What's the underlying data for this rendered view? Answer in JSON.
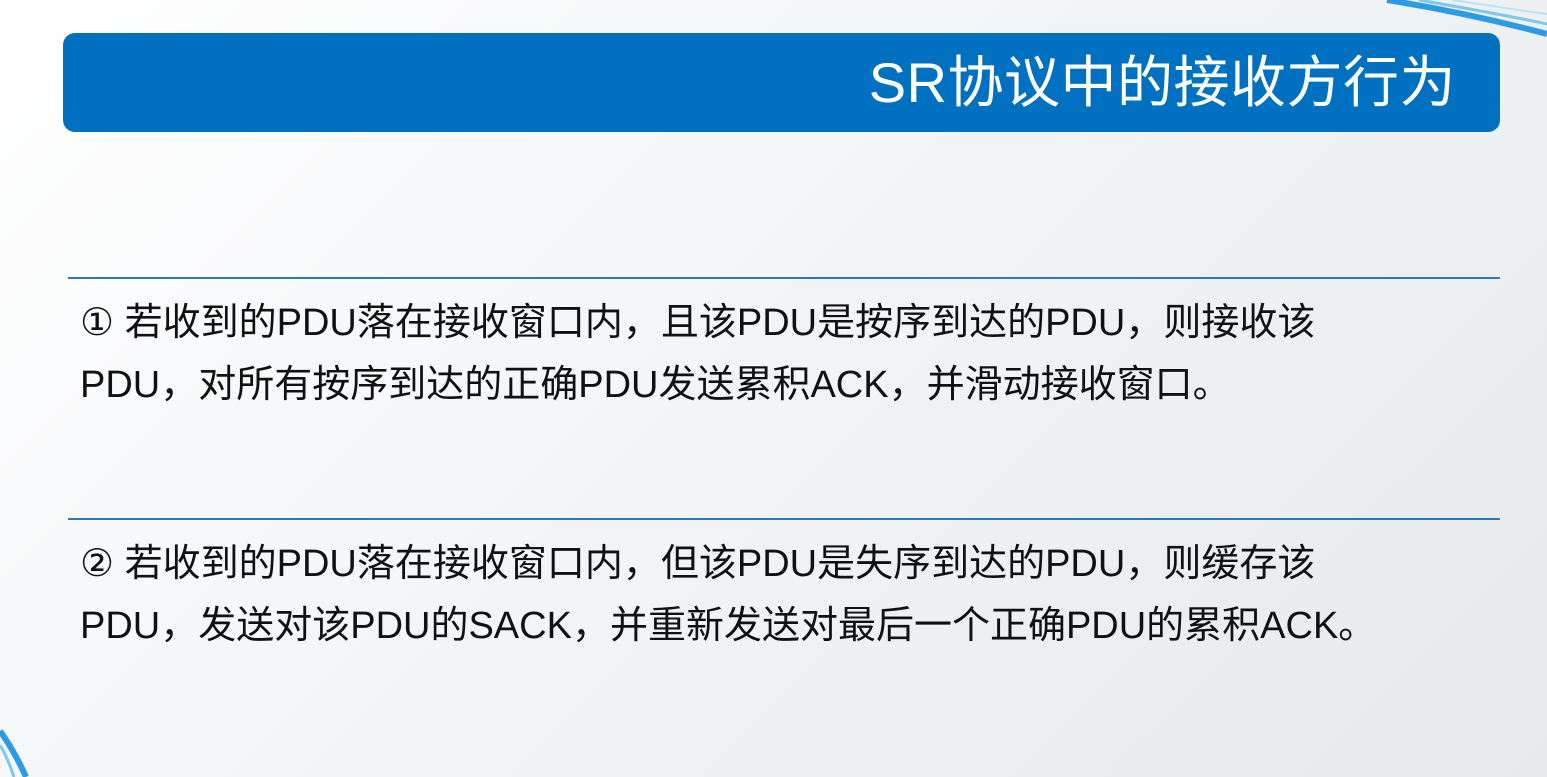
{
  "slide": {
    "title": "SR协议中的接收方行为",
    "points": [
      {
        "lines": [
          "① 若收到的PDU落在接收窗口内，且该PDU是按序到达的PDU，则接收该",
          "PDU，对所有按序到达的正确PDU发送累积ACK，并滑动接收窗口。"
        ]
      },
      {
        "lines": [
          "② 若收到的PDU落在接收窗口内，但该PDU是失序到达的PDU，则缓存该",
          "PDU，发送对该PDU的SACK，并重新发送对最后一个正确PDU的累积ACK。"
        ]
      }
    ]
  },
  "theme": {
    "title_bar_color": "#0070c0",
    "title_text_color": "#ffffff",
    "rule_color": "#2f78b8",
    "text_color": "#111111",
    "accent_swoosh_color": "#2b9be6"
  }
}
